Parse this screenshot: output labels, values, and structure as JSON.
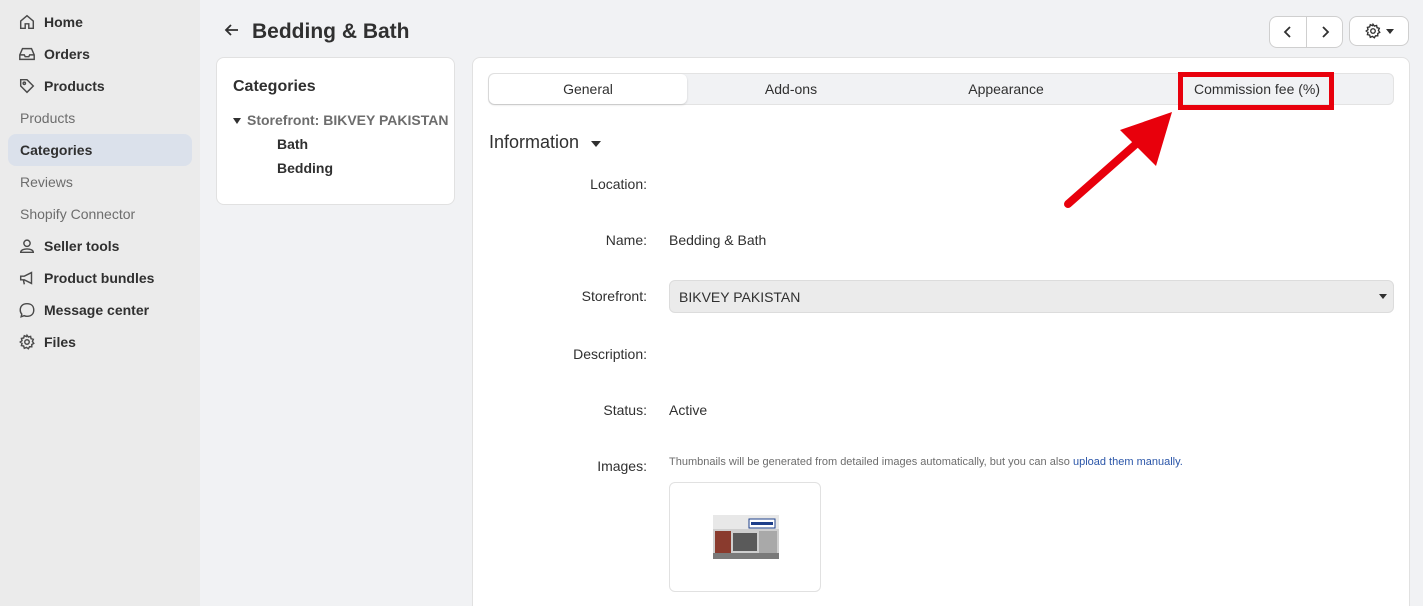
{
  "sidebar": {
    "items": [
      {
        "label": "Home",
        "icon": "home-icon",
        "type": "main"
      },
      {
        "label": "Orders",
        "icon": "inbox-icon",
        "type": "main"
      },
      {
        "label": "Products",
        "icon": "tag-icon",
        "type": "main"
      },
      {
        "label": "Products",
        "type": "sub"
      },
      {
        "label": "Categories",
        "type": "sub",
        "active": true
      },
      {
        "label": "Reviews",
        "type": "sub"
      },
      {
        "label": "Shopify Connector",
        "type": "sub"
      },
      {
        "label": "Seller tools",
        "icon": "person-icon",
        "type": "main"
      },
      {
        "label": "Product bundles",
        "icon": "megaphone-icon",
        "type": "main"
      },
      {
        "label": "Message center",
        "icon": "chat-bubble-icon",
        "type": "main"
      },
      {
        "label": "Files",
        "icon": "gear-icon",
        "type": "main"
      }
    ]
  },
  "header": {
    "title": "Bedding & Bath"
  },
  "categories_card": {
    "title": "Categories",
    "storefront": "Storefront: BIKVEY PAKISTAN",
    "items": [
      "Bath",
      "Bedding"
    ]
  },
  "tabs": [
    {
      "label": "General",
      "active": true
    },
    {
      "label": "Add-ons"
    },
    {
      "label": "Appearance"
    },
    {
      "label": "Commission fee (%)"
    }
  ],
  "form": {
    "section_title": "Information",
    "location_label": "Location:",
    "name_label": "Name:",
    "name_value": "Bedding & Bath",
    "storefront_label": "Storefront:",
    "storefront_value": "BIKVEY PAKISTAN",
    "description_label": "Description:",
    "status_label": "Status:",
    "status_value": "Active",
    "images_label": "Images:",
    "images_hint": "Thumbnails will be generated from detailed images automatically, but you can also ",
    "images_hint_link": "upload them manually."
  },
  "colors": {
    "highlight": "#e8000c",
    "active_nav": "#dbe1eb",
    "link": "#2a55a8"
  }
}
